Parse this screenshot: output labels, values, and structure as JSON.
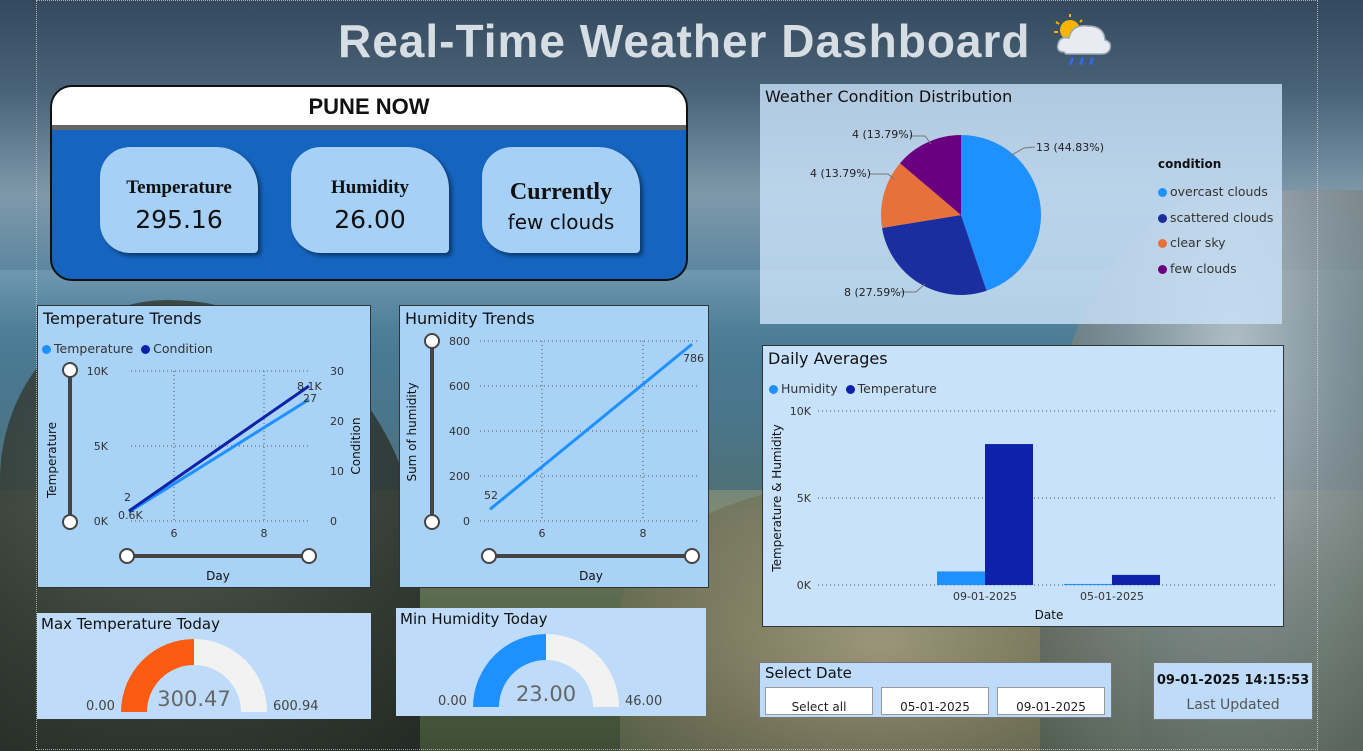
{
  "title": "Real-Time Weather Dashboard",
  "colors": {
    "accent_blue": "#1e90ff",
    "navy": "#0d22a8",
    "orange": "#e8703a",
    "purple": "#6a0080",
    "gauge_orange": "#fb5c12"
  },
  "now_card": {
    "header": "PUNE NOW",
    "temperature_label": "Temperature",
    "temperature_value": "295.16",
    "humidity_label": "Humidity",
    "humidity_value": "26.00",
    "current_label": "Currently",
    "current_value": "few clouds"
  },
  "pie": {
    "title": "Weather Condition Distribution",
    "legend_title": "condition",
    "slice_labels": [
      "13 (44.83%)",
      "8 (27.59%)",
      "4 (13.79%)",
      "4 (13.79%)"
    ]
  },
  "temp_trends": {
    "title": "Temperature Trends",
    "legend": [
      "Temperature",
      "Condition"
    ],
    "ylabel_left": "Temperature",
    "ylabel_right": "Condition",
    "xlabel": "Day",
    "yticks_left": [
      "10K",
      "5K",
      "0K"
    ],
    "yticks_right": [
      "30",
      "20",
      "10",
      "0"
    ],
    "xticks": [
      "6",
      "8"
    ],
    "labels": [
      "2",
      "0.6K",
      "8.1K",
      "27"
    ]
  },
  "hum_trends": {
    "title": "Humidity Trends",
    "ylabel": "Sum of humidity",
    "xlabel": "Day",
    "yticks": [
      "800",
      "600",
      "400",
      "200",
      "0"
    ],
    "xticks": [
      "6",
      "8"
    ],
    "labels": [
      "52",
      "786"
    ]
  },
  "daily": {
    "title": "Daily Averages",
    "legend": [
      "Humidity",
      "Temperature"
    ],
    "ylabel": "Temperature & Humidity",
    "xlabel": "Date",
    "yticks": [
      "10K",
      "5K",
      "0K"
    ],
    "xticks": [
      "09-01-2025",
      "05-01-2025"
    ]
  },
  "max_temp": {
    "title": "Max Temperature Today",
    "min": "0.00",
    "value": "300.47",
    "max": "600.94"
  },
  "min_hum": {
    "title": "Min Humidity Today",
    "min": "0.00",
    "value": "23.00",
    "max": "46.00"
  },
  "slicer": {
    "title": "Select Date",
    "options": [
      "Select all",
      "05-01-2025",
      "09-01-2025"
    ]
  },
  "updated": {
    "timestamp": "09-01-2025 14:15:53",
    "label": "Last Updated"
  },
  "chart_data": [
    {
      "type": "pie",
      "title": "Weather Condition Distribution",
      "legend_title": "condition",
      "categories": [
        "overcast clouds",
        "scattered clouds",
        "clear sky",
        "few clouds"
      ],
      "values": [
        13,
        8,
        4,
        4
      ],
      "percent": [
        44.83,
        27.59,
        13.79,
        13.79
      ],
      "colors": [
        "#1e90ff",
        "#1a2ea0",
        "#e8703a",
        "#6a0080"
      ],
      "legend_position": "right"
    },
    {
      "type": "line",
      "title": "Temperature Trends",
      "xlabel": "Day",
      "x": [
        5,
        9
      ],
      "series": [
        {
          "name": "Temperature",
          "axis": "left",
          "values": [
            600,
            8100
          ]
        },
        {
          "name": "Condition",
          "axis": "right",
          "values": [
            2,
            27
          ]
        }
      ],
      "xlim": [
        5,
        9
      ],
      "ylim_left": [
        0,
        10000
      ],
      "ylim_right": [
        0,
        30
      ],
      "ylabel_left": "Temperature",
      "ylabel_right": "Condition"
    },
    {
      "type": "line",
      "title": "Humidity Trends",
      "xlabel": "Day",
      "ylabel": "Sum of humidity",
      "x": [
        5,
        9
      ],
      "series": [
        {
          "values": [
            52,
            786
          ]
        }
      ],
      "xlim": [
        5,
        9
      ],
      "ylim": [
        0,
        800
      ]
    },
    {
      "type": "bar",
      "title": "Daily Averages",
      "xlabel": "Date",
      "ylabel": "Temperature & Humidity",
      "categories": [
        "09-01-2025",
        "05-01-2025"
      ],
      "series": [
        {
          "name": "Humidity",
          "values": [
            780,
            60
          ]
        },
        {
          "name": "Temperature",
          "values": [
            8100,
            580
          ]
        }
      ],
      "ylim": [
        0,
        10000
      ]
    }
  ]
}
